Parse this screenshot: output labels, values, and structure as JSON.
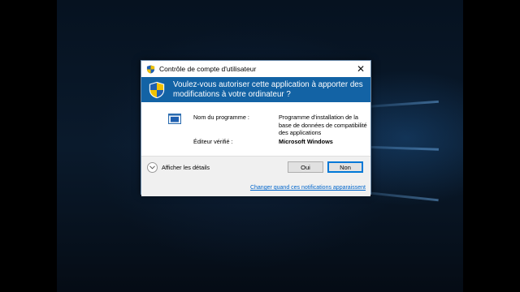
{
  "window": {
    "title": "Contrôle de compte d'utilisateur",
    "close_glyph": "✕"
  },
  "banner": {
    "question": "Voulez-vous autoriser cette application à apporter des modifications à votre ordinateur ?",
    "icon": "uac-shield-icon"
  },
  "details": {
    "program_label": "Nom du programme :",
    "program_value": "Programme d'installation de la base de données de compatibilité des applications",
    "publisher_label": "Éditeur vérifié :",
    "publisher_value": "Microsoft Windows"
  },
  "footer": {
    "show_details_label": "Afficher les détails",
    "yes_label": "Oui",
    "no_label": "Non",
    "notification_link": "Changer quand ces notifications apparaissent"
  },
  "colors": {
    "banner_bg": "#1363a5",
    "link": "#0066cc",
    "focus_border": "#0078d7"
  }
}
